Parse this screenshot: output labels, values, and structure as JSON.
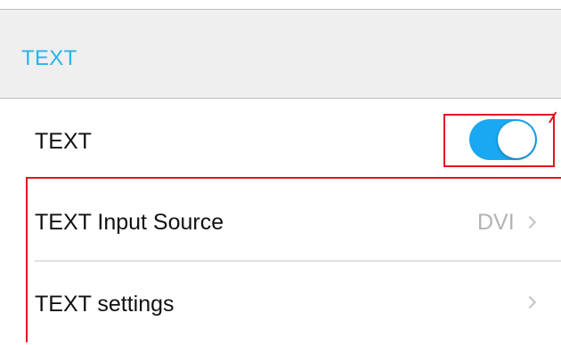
{
  "section": {
    "title": "TEXT"
  },
  "rows": [
    {
      "label": "TEXT",
      "control": "toggle",
      "toggle_on": true
    },
    {
      "label": "TEXT Input Source",
      "value": "DVI",
      "control": "disclosure"
    },
    {
      "label": "TEXT settings",
      "value": "",
      "control": "disclosure"
    }
  ],
  "colors": {
    "accent": "#27b5e9",
    "toggle_on": "#1aa8f2",
    "annotation": "#e3141e",
    "header_background": "#efefef",
    "secondary_text": "#b3b3b3"
  },
  "icons": {
    "disclosure": "chevron-right-icon"
  }
}
